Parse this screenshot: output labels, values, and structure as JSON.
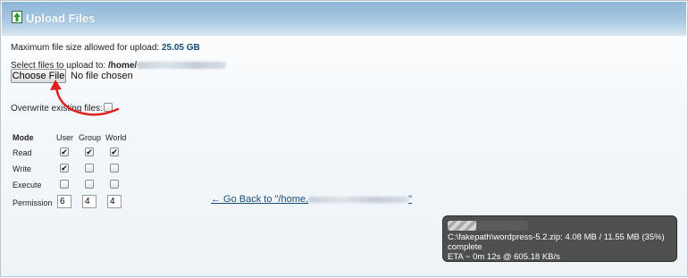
{
  "header": {
    "title": "Upload Files",
    "icon": "upload-arrow-icon"
  },
  "upload": {
    "max_size_label": "Maximum file size allowed for upload:",
    "max_size_value": "25.05 GB",
    "select_label": "Select files to upload to:",
    "select_path_prefix": "/home/",
    "choose_button": "Choose File",
    "no_file_text": "No file chosen",
    "overwrite_label": "Overwrite existing files:",
    "overwrite_checked": false
  },
  "permissions": {
    "mode_label": "Mode",
    "columns": [
      "User",
      "Group",
      "World"
    ],
    "rows": [
      {
        "label": "Read",
        "values": [
          true,
          true,
          true
        ]
      },
      {
        "label": "Write",
        "values": [
          true,
          false,
          false
        ]
      },
      {
        "label": "Execute",
        "values": [
          false,
          false,
          false
        ]
      }
    ],
    "permission_label": "Permission",
    "permission_values": [
      "6",
      "4",
      "4"
    ]
  },
  "go_back": {
    "text_prefix": "← Go Back to \"/home,",
    "text_suffix": "\""
  },
  "progress": {
    "file_line": "C:\\fakepath\\wordpress-5.2.zip: 4.08 MB / 11.55 MB (35%)",
    "status": "complete",
    "eta_line": "ETA ~ 0m 12s @ 605.18 KB/s",
    "fraction": 0.35
  },
  "colors": {
    "header_gradient_top": "#8db6d8",
    "link": "#1a4d79",
    "annotation_arrow": "#e02020",
    "progress_bg": "#424242"
  }
}
